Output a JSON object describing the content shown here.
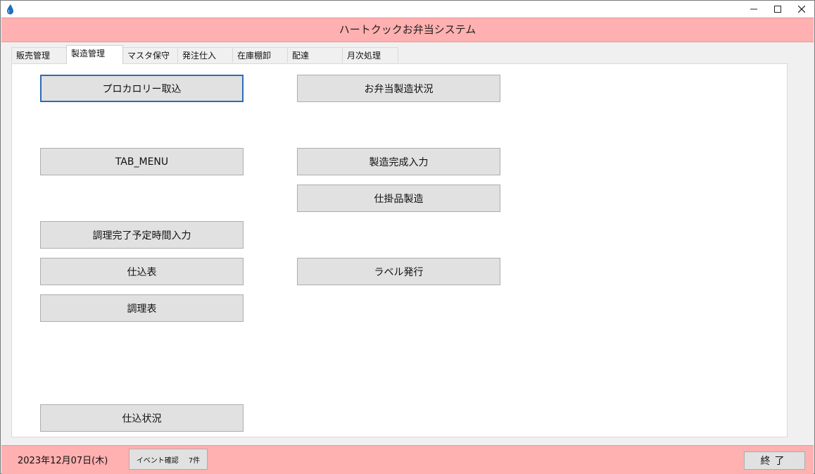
{
  "header": {
    "title": "ハートクックお弁当システム"
  },
  "tabs": [
    {
      "label": "販売管理",
      "active": false
    },
    {
      "label": "製造管理",
      "active": true
    },
    {
      "label": "マスタ保守",
      "active": false
    },
    {
      "label": "発注仕入",
      "active": false
    },
    {
      "label": "在庫棚卸",
      "active": false
    },
    {
      "label": "配達",
      "active": false
    },
    {
      "label": "月次処理",
      "active": false
    }
  ],
  "buttons": {
    "pro_calorie": "プロカロリー取込",
    "tab_menu": "TAB_MENU",
    "cooking_time": "調理完了予定時間入力",
    "purchase_sheet": "仕込表",
    "cooking_sheet": "調理表",
    "purchase_status": "仕込状況",
    "bento_status": "お弁当製造状況",
    "production_input": "製造完成入力",
    "wip_production": "仕掛品製造",
    "label_issue": "ラベル発行"
  },
  "status": {
    "date": "2023年12月07日(木)",
    "event_label": "イベント確認",
    "event_count": "7件",
    "exit_label": "終了"
  },
  "colors": {
    "header_bg": "#ffb0b0",
    "focus_border": "#2a6db5"
  }
}
